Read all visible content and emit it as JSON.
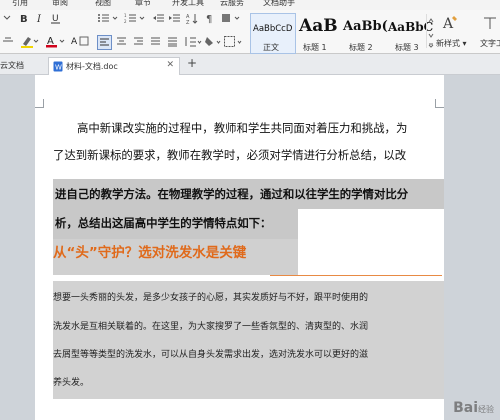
{
  "ribbon": {
    "menu_tabs": [
      "引用",
      "审阅",
      "视图",
      "章节",
      "开发工具",
      "云服务",
      "文档助手"
    ],
    "styles": [
      {
        "preview": "AaBbCcD",
        "name": "正文"
      },
      {
        "preview": "AaB",
        "name": "标题 1"
      },
      {
        "preview": "AaBb(",
        "name": "标题 2"
      },
      {
        "preview": "AaBbC",
        "name": "标题 3"
      }
    ],
    "new_style_label": "新样式 ▾",
    "text_tools_label": "文字工"
  },
  "tabs": {
    "cloud_doc": "云文档",
    "active_doc": "材料-文档.doc",
    "new_tab": "+"
  },
  "document": {
    "para1_line1": "高中新课改实施的过程中，教师和学生共同面对着压力和挑战，为",
    "para1_line2": "了达到新课标的要求，教师在教学时，必须对学情进行分析总结，以改",
    "bold_line1": "进自己的教学方法。在物理教学的过程，通过和以往学生的学情对比分",
    "bold_line2": "析，总结出这届高中学生的学情特点如下：",
    "orange_title": "从“头”守护？选对洗发水是关键",
    "body_line1": "想要一头秀丽的头发，是多少女孩子的心愿，其实发质好与不好，跟平时使用的",
    "body_line2": "洗发水是互相关联着的。在这里，为大家搜罗了一些香氛型的、清爽型的、水润",
    "body_line3": "去屑型等等类型的洗发水，可以从自身头发需求出发，选对洗发水可以更好的滋",
    "body_line4": "养头发。"
  },
  "watermark": {
    "text": "Bai",
    "sub": "经验"
  },
  "colors": {
    "accent_orange": "#e06a1b",
    "highlight_gray": "#c8c8c8",
    "font_color_red": "#d0021b"
  }
}
